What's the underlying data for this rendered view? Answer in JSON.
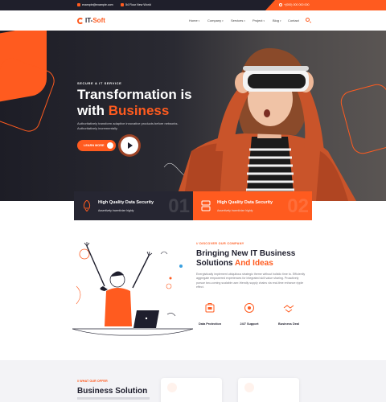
{
  "topbar": {
    "email": "example@example.com",
    "location": "54 Flour New World",
    "phone": "+(000) 000 000 000"
  },
  "header": {
    "logo_it": "IT-",
    "logo_soft": "Soft",
    "nav": [
      {
        "label": "Home"
      },
      {
        "label": "Company"
      },
      {
        "label": "Services"
      },
      {
        "label": "Project"
      },
      {
        "label": "Blog"
      },
      {
        "label": "Contact"
      }
    ]
  },
  "hero": {
    "tag": "SECURE & IT SERVICE",
    "title_line1": "Transformation is",
    "title_line2_prefix": "with ",
    "title_line2_highlight": "Business",
    "description": "Authoritatively transform adaptive innovative products before networks. Authoritatively incrementally.",
    "learn_more": "LEARN MORE"
  },
  "features": [
    {
      "title": "High Quality Data Security",
      "subtitle": "Assertively incentivize highly",
      "number": "01"
    },
    {
      "title": "High Quality Data Security",
      "subtitle": "Assertively incentivize highly",
      "number": "02"
    }
  ],
  "about": {
    "tag": "// DISCOVER OUR COMPANY",
    "title_line1": "Bringing New IT Business",
    "title_line2_prefix": "Solutions ",
    "title_line2_highlight": "And Ideas",
    "description": "Energistically implement ubiquitous strategic theme without holistic time to. Efficiently aggregate empowered experiences for integrated skill value sharing. Proactively pursue two-coming scalable user-friendly supply chains via real-time enhance ripple effect.",
    "services": [
      {
        "label": "Data Protection",
        "icon": "shield-lock-icon"
      },
      {
        "label": "24/7 Support",
        "icon": "headset-icon"
      },
      {
        "label": "Business Deal",
        "icon": "handshake-icon"
      }
    ]
  },
  "offer": {
    "tag": "// WHAT OUR OFFER",
    "title": "Business Solution"
  },
  "colors": {
    "accent": "#ff5b1f",
    "dark": "#1e1e2d"
  }
}
